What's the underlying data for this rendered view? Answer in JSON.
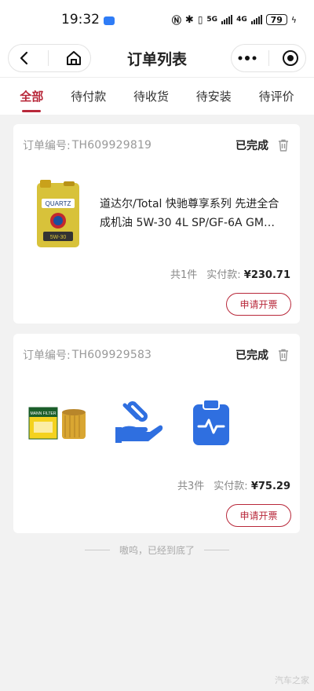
{
  "status_bar": {
    "time": "19:32",
    "network_5g": "5G",
    "network_4g": "4G",
    "battery": "79"
  },
  "nav": {
    "title": "订单列表"
  },
  "tabs": [
    {
      "label": "全部",
      "active": true
    },
    {
      "label": "待付款",
      "active": false
    },
    {
      "label": "待收货",
      "active": false
    },
    {
      "label": "待安装",
      "active": false
    },
    {
      "label": "待评价",
      "active": false
    }
  ],
  "orders": [
    {
      "order_label": "订单编号:",
      "order_no": "TH609929819",
      "status": "已完成",
      "product_name": "道达尔/Total 快驰尊享系列 先进全合成机油 5W-30 4L SP/GF-6A GM…",
      "product_image_text": "QUARTZ",
      "count": "共1件",
      "paid_label": "实付款:",
      "price": "¥230.71",
      "invoice_label": "申请开票"
    },
    {
      "order_label": "订单编号:",
      "order_no": "TH609929583",
      "status": "已完成",
      "filter_brand": "MANN FILTER",
      "count": "共3件",
      "paid_label": "实付款:",
      "price": "¥75.29",
      "invoice_label": "申请开票"
    }
  ],
  "footer": {
    "end_text": "嗷呜，已经到底了"
  },
  "watermark": "汽车之家",
  "colors": {
    "accent": "#b8283a",
    "background": "#f2f2f2",
    "icon_blue": "#2f6fe0"
  }
}
